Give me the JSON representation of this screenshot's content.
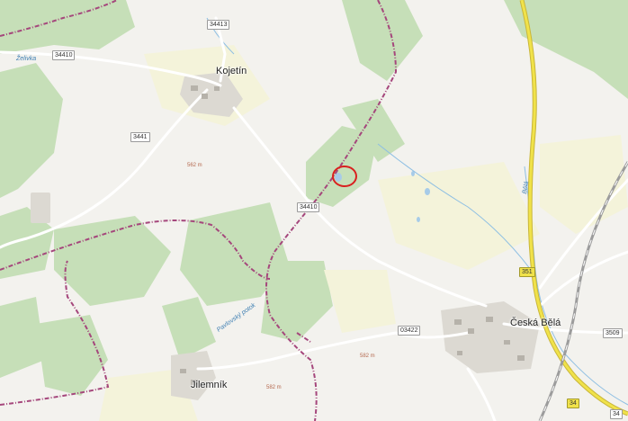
{
  "map": {
    "places": [
      {
        "key": "kojetin",
        "name": "Kojetín"
      },
      {
        "key": "ceska-bela",
        "name": "Česká Bělá"
      },
      {
        "key": "jilemnik",
        "name": "Jilemník"
      }
    ],
    "road_numbers": [
      "34413",
      "34410",
      "3441",
      "34410",
      "351",
      "3509",
      "03422",
      "34",
      "34"
    ],
    "elevations": [
      "562 m",
      "582 m",
      "582 m"
    ],
    "streams": [
      "Želivka",
      "Bělá",
      "Pavlovský potok"
    ],
    "colors": {
      "background": "#f3f2ee",
      "forest": "#c6dfb8",
      "meadow": "#f4f3da",
      "road": "#ffffff",
      "main_road": "#f0e24a",
      "hiking_trail": "#a5477c",
      "water": "#a7cbe8",
      "marker": "#d9201f"
    },
    "marker": {
      "label": "selected point"
    }
  }
}
